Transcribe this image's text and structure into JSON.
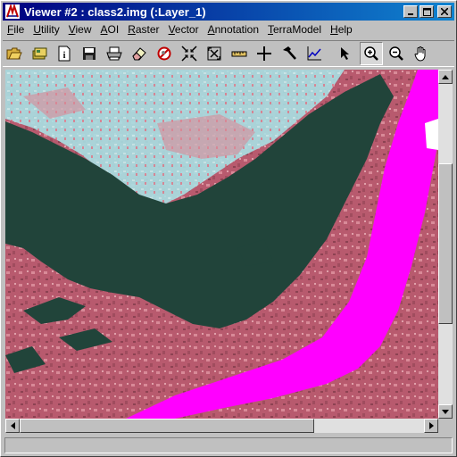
{
  "window": {
    "title": "Viewer #2 : class2.img (:Layer_1)"
  },
  "menubar": {
    "items": [
      {
        "label": "File",
        "mnemonic": "F",
        "rest": "ile"
      },
      {
        "label": "Utility",
        "mnemonic": "U",
        "rest": "tility"
      },
      {
        "label": "View",
        "mnemonic": "V",
        "rest": "iew"
      },
      {
        "label": "AOI",
        "mnemonic": "A",
        "rest": "OI"
      },
      {
        "label": "Raster",
        "mnemonic": "R",
        "rest": "aster"
      },
      {
        "label": "Vector",
        "mnemonic": "V",
        "rest": "ector"
      },
      {
        "label": "Annotation",
        "mnemonic": "A",
        "rest": "nnotation"
      },
      {
        "label": "TerraModel",
        "mnemonic": "T",
        "rest": "erraModel"
      },
      {
        "label": "Help",
        "mnemonic": "H",
        "rest": "elp"
      }
    ]
  },
  "toolbar": {
    "tools": [
      "open-folder-icon",
      "open-layer-icon",
      "info-icon",
      "save-icon",
      "print-icon",
      "eraser-icon",
      "clear-icon",
      "zoom-in-fit-icon",
      "zoom-out-fit-icon",
      "measure-icon",
      "crosshair-icon",
      "hammer-icon",
      "profile-icon",
      "select-arrow-icon",
      "zoom-in-icon",
      "zoom-out-icon",
      "pan-hand-icon"
    ],
    "active_tool": "zoom-in-icon"
  },
  "colors": {
    "water_dark": "#21443a",
    "river_magenta": "#ff00ff",
    "land_red": "#b85a6e",
    "land_pink": "#d98a98",
    "cloud_cyan": "#a8e0e4",
    "title_gradient_start": "#000080",
    "title_gradient_end": "#1084d0"
  },
  "scrollbars": {
    "vertical_thumb_fraction": 0.5,
    "horizontal_thumb_fraction": 0.0
  }
}
